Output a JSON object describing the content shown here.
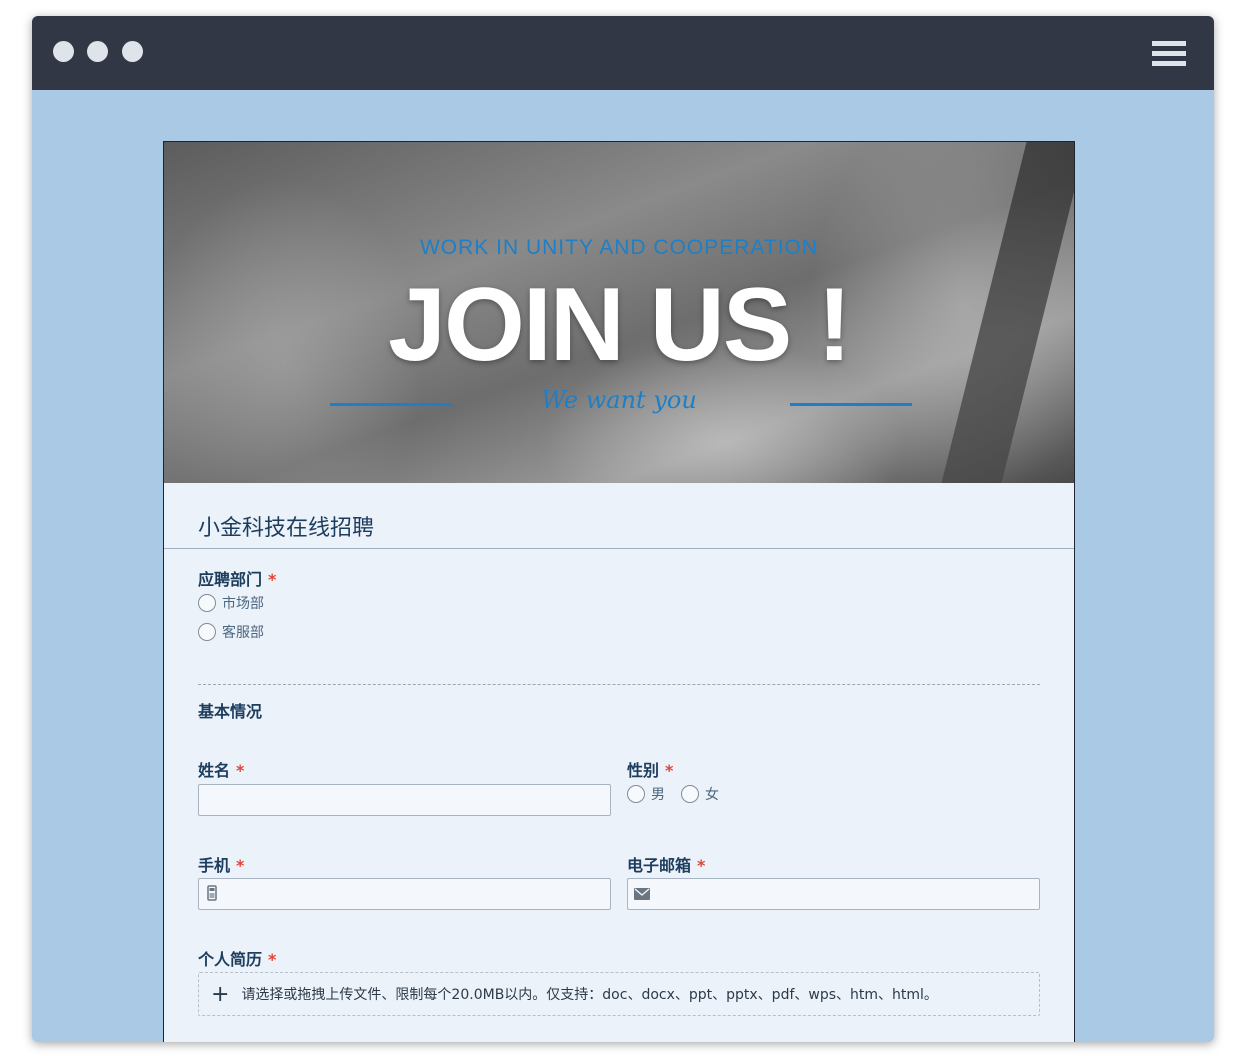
{
  "banner": {
    "subtitle": "WORK IN UNITY AND COOPERATION",
    "title": "JOIN US !",
    "script_line": "We want you"
  },
  "form": {
    "title": "小金科技在线招聘",
    "department": {
      "label": "应聘部门",
      "required": "*",
      "options": [
        "市场部",
        "客服部"
      ]
    },
    "section_basic": "基本情况",
    "name": {
      "label": "姓名",
      "required": "*",
      "value": ""
    },
    "gender": {
      "label": "性别",
      "required": "*",
      "options": [
        "男",
        "女"
      ]
    },
    "phone": {
      "label": "手机",
      "required": "*",
      "value": "",
      "icon": "phone-icon"
    },
    "email": {
      "label": "电子邮箱",
      "required": "*",
      "value": "",
      "icon": "envelope-icon"
    },
    "resume": {
      "label": "个人简历",
      "required": "*",
      "hint": "请选择或拖拽上传文件、限制每个20.0MB以内。仅支持：doc、docx、ppt、pptx、pdf、wps、htm、html。"
    }
  },
  "colors": {
    "titlebar": "#323745",
    "page_background": "#aac9e4",
    "form_background": "#ecf2fa",
    "accent_blue": "#1e7fc6",
    "label_text": "#1d3d5e",
    "required_star": "#e04535"
  }
}
